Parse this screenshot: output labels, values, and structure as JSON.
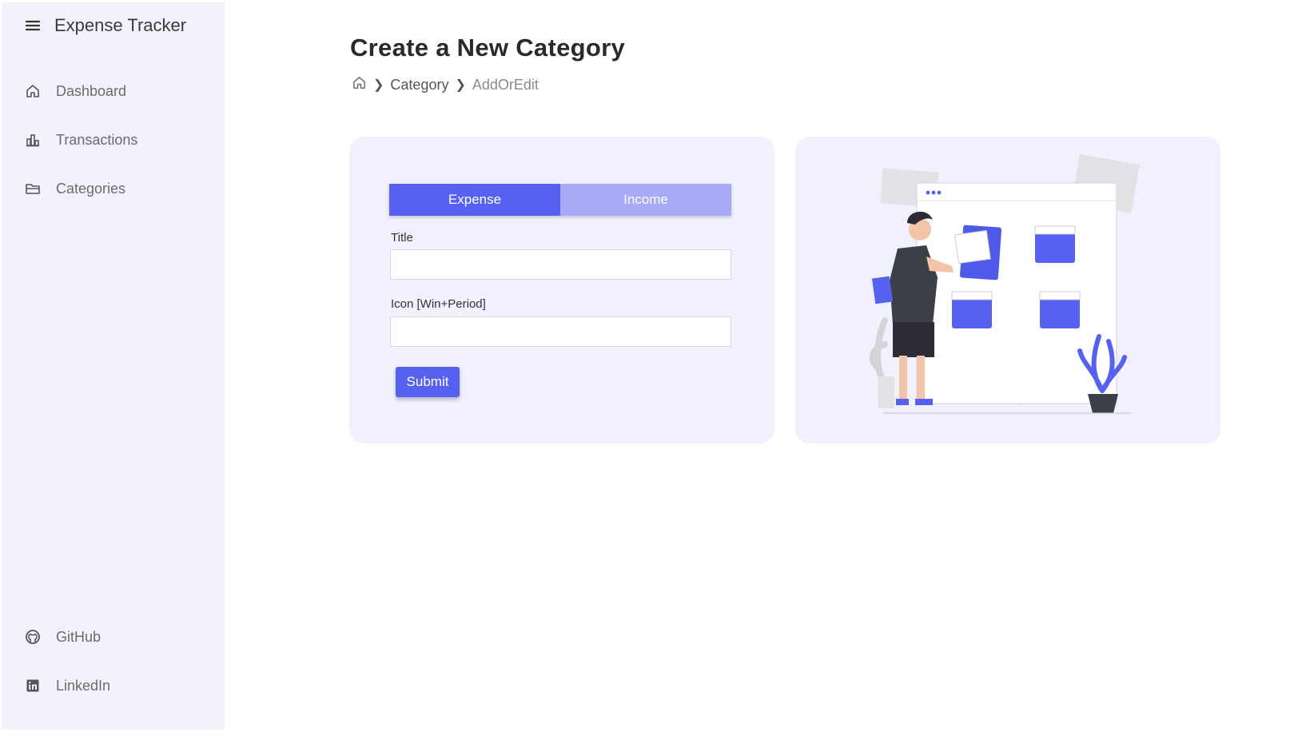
{
  "app": {
    "title": "Expense Tracker"
  },
  "sidebar": {
    "items": [
      {
        "label": "Dashboard",
        "icon": "home-icon"
      },
      {
        "label": "Transactions",
        "icon": "bar-chart-icon"
      },
      {
        "label": "Categories",
        "icon": "folder-icon"
      }
    ],
    "footer_items": [
      {
        "label": "GitHub",
        "icon": "github-icon"
      },
      {
        "label": "LinkedIn",
        "icon": "linkedin-icon"
      }
    ]
  },
  "page": {
    "title": "Create a New Category",
    "breadcrumb": [
      "Category",
      "AddOrEdit"
    ]
  },
  "form": {
    "type_options": [
      "Expense",
      "Income"
    ],
    "selected_type": "Expense",
    "title_label": "Title",
    "title_value": "",
    "icon_label": "Icon [Win+Period]",
    "icon_value": "",
    "submit_label": "Submit"
  },
  "colors": {
    "accent": "#5661f0",
    "accent_light": "#a6aaf7",
    "sidebar_bg": "#f2f2fd",
    "card_bg": "#f1f1fd"
  }
}
